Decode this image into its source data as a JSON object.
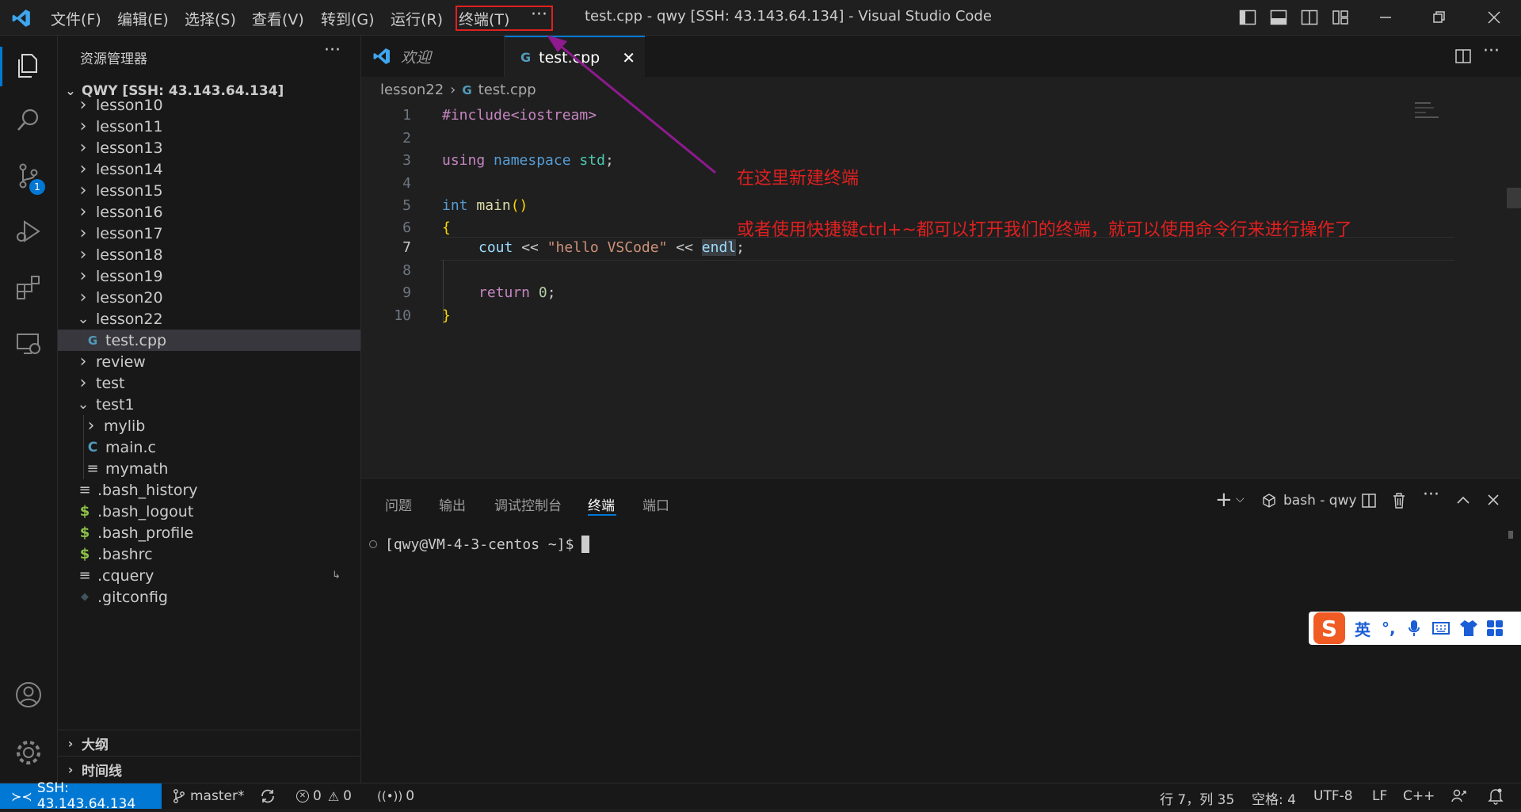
{
  "titlebar": {
    "menus": [
      "文件(F)",
      "编辑(E)",
      "选择(S)",
      "查看(V)",
      "转到(G)",
      "运行(R)",
      "终端(T)",
      "···"
    ],
    "title": "test.cpp - qwy [SSH: 43.143.64.134] - Visual Studio Code"
  },
  "activity": {
    "source_control_badge": "1"
  },
  "sidebar": {
    "header": "资源管理器",
    "root": "QWY [SSH: 43.143.64.134]",
    "items": [
      {
        "label": "lesson10",
        "kind": "folder-closed"
      },
      {
        "label": "lesson11",
        "kind": "folder-closed"
      },
      {
        "label": "lesson13",
        "kind": "folder-closed"
      },
      {
        "label": "lesson14",
        "kind": "folder-closed"
      },
      {
        "label": "lesson15",
        "kind": "folder-closed"
      },
      {
        "label": "lesson16",
        "kind": "folder-closed"
      },
      {
        "label": "lesson17",
        "kind": "folder-closed"
      },
      {
        "label": "lesson18",
        "kind": "folder-closed"
      },
      {
        "label": "lesson19",
        "kind": "folder-closed"
      },
      {
        "label": "lesson20",
        "kind": "folder-closed"
      },
      {
        "label": "lesson22",
        "kind": "folder-open"
      },
      {
        "label": "test.cpp",
        "kind": "file-cpp"
      },
      {
        "label": "review",
        "kind": "folder-closed"
      },
      {
        "label": "test",
        "kind": "folder-closed"
      },
      {
        "label": "test1",
        "kind": "folder-open"
      },
      {
        "label": "mylib",
        "kind": "folder-closed"
      },
      {
        "label": "main.c",
        "kind": "file-c"
      },
      {
        "label": "mymath",
        "kind": "file-text"
      },
      {
        "label": ".bash_history",
        "kind": "file-text"
      },
      {
        "label": ".bash_logout",
        "kind": "file-shell"
      },
      {
        "label": ".bash_profile",
        "kind": "file-shell"
      },
      {
        "label": ".bashrc",
        "kind": "file-shell"
      },
      {
        "label": ".cquery",
        "kind": "file-text"
      },
      {
        "label": ".gitconfig",
        "kind": "file-git"
      }
    ],
    "outline": "大纲",
    "timeline": "时间线"
  },
  "tabs": [
    {
      "label": "欢迎"
    },
    {
      "label": "test.cpp"
    }
  ],
  "breadcrumb": {
    "folder": "lesson22",
    "file": "test.cpp"
  },
  "code": {
    "line_numbers": [
      "1",
      "2",
      "3",
      "4",
      "5",
      "6",
      "7",
      "8",
      "9",
      "10"
    ],
    "l1": "#include<iostream>",
    "l3_a": "using",
    "l3_b": "namespace",
    "l3_c": "std",
    "l3_d": ";",
    "l5_a": "int",
    "l5_b": "main",
    "l5_c": "()",
    "l6": "{",
    "l7_a": "cout",
    "l7_b": " << ",
    "l7_c": "\"hello VSCode\"",
    "l7_d": " << ",
    "l7_e": "endl",
    "l7_f": ";",
    "l9_a": "return",
    "l9_b": "0",
    "l9_c": ";",
    "l10": "}"
  },
  "annotation": {
    "line1": "在这里新建终端",
    "line2": "或者使用快捷键ctrl+~都可以打开我们的终端，就可以使用命令行来进行操作了"
  },
  "panel": {
    "tabs": [
      "问题",
      "输出",
      "调试控制台",
      "终端",
      "端口"
    ],
    "active_tab": "终端",
    "terminal_name": "bash - qwy",
    "prompt": "[qwy@VM-4-3-centos ~]$"
  },
  "ime": {
    "lang": "英"
  },
  "status": {
    "remote": "SSH: 43.143.64.134",
    "branch": "master*",
    "errors": "0",
    "warnings": "0",
    "ports": "0",
    "position": "行 7，列 35",
    "spaces": "空格: 4",
    "encoding": "UTF-8",
    "eol": "LF",
    "language": "C++"
  },
  "colors": {
    "accent": "#0078d4",
    "annotation": "#e02020",
    "highlight_box": "#e02020",
    "arrow": "#8e1a8e"
  }
}
